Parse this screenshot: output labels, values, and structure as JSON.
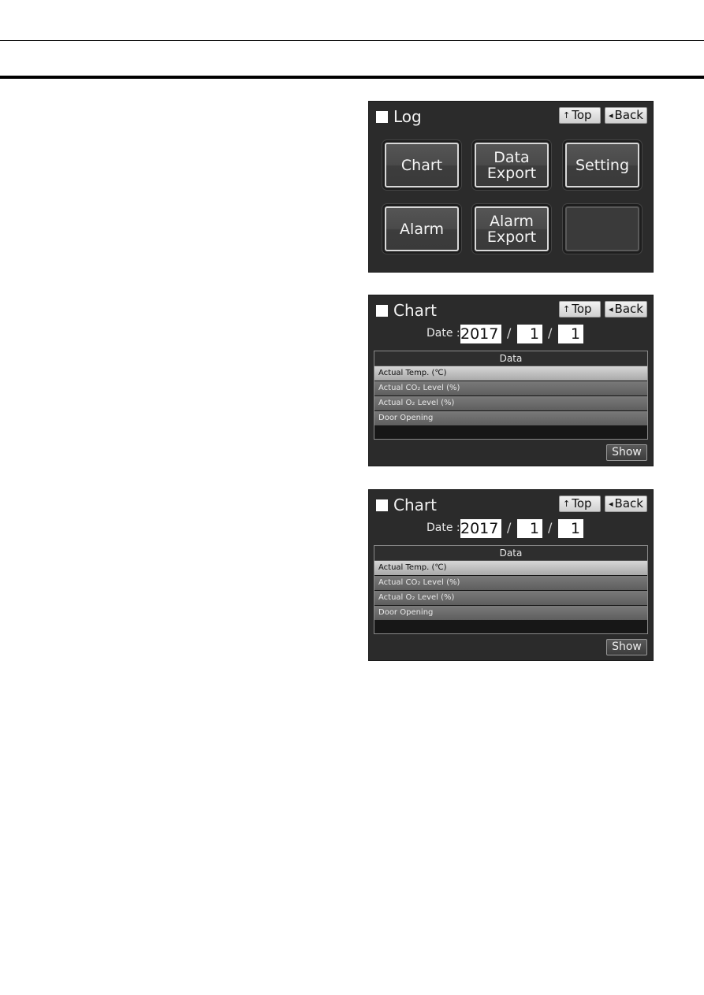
{
  "log_screen": {
    "title": "Log",
    "nav": {
      "top": "Top",
      "back": "Back",
      "top_glyph": "↑",
      "back_glyph": "◂"
    },
    "tiles": [
      {
        "lines": [
          "Chart"
        ]
      },
      {
        "lines": [
          "Data",
          "Export"
        ]
      },
      {
        "lines": [
          "Setting"
        ]
      },
      {
        "lines": [
          "Alarm"
        ]
      },
      {
        "lines": [
          "Alarm",
          "Export"
        ]
      },
      {
        "lines": [
          ""
        ]
      }
    ]
  },
  "chart_screens": [
    {
      "title": "Chart",
      "nav": {
        "top": "Top",
        "back": "Back",
        "top_glyph": "↑",
        "back_glyph": "◂"
      },
      "date_label": "Date :",
      "date": {
        "year": "2017",
        "month": "1",
        "day": "1",
        "separator": "/"
      },
      "data_header": "Data",
      "items": [
        "Actual Temp. (℃)",
        "Actual CO₂ Level (%)",
        "Actual O₂ Level (%)",
        "Door Opening"
      ],
      "selected_index": 0,
      "show_label": "Show"
    },
    {
      "title": "Chart",
      "nav": {
        "top": "Top",
        "back": "Back",
        "top_glyph": "↑",
        "back_glyph": "◂"
      },
      "date_label": "Date :",
      "date": {
        "year": "2017",
        "month": "1",
        "day": "1",
        "separator": "/"
      },
      "data_header": "Data",
      "items": [
        "Actual Temp. (℃)",
        "Actual CO₂ Level (%)",
        "Actual O₂ Level (%)",
        "Door Opening"
      ],
      "selected_index": 0,
      "show_label": "Show"
    }
  ],
  "colors": {
    "screen_bg": "#2b2b2b",
    "selected_row": "#c4c4c4",
    "row": "#6a6a6a"
  }
}
